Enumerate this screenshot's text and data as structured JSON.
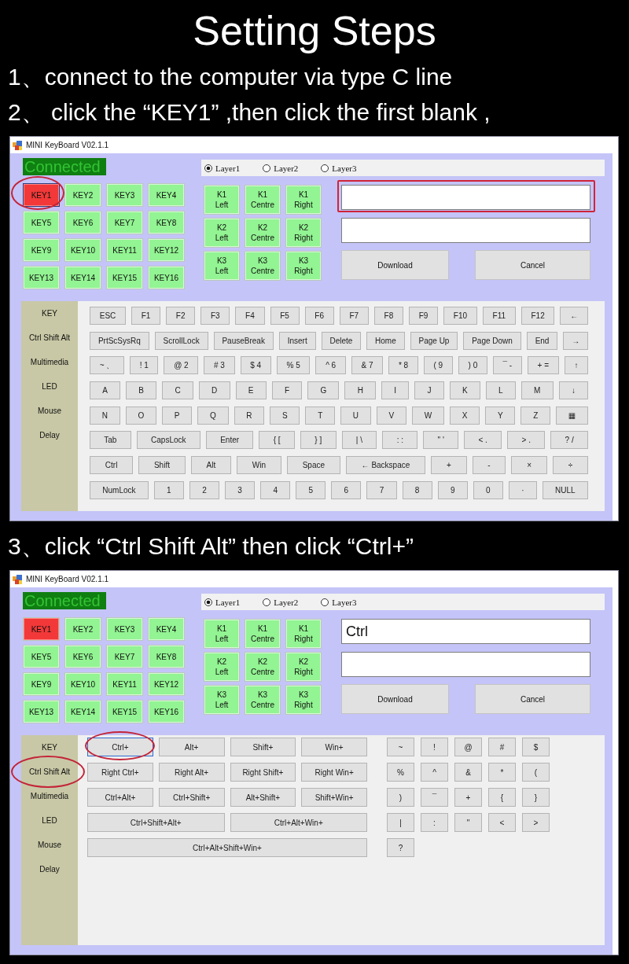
{
  "title": "Setting Steps",
  "sections": [
    {
      "steps": [
        "1、connect to the computer via type C line",
        "2、 click the “KEY1” ,then click the first blank ,"
      ],
      "window": {
        "title": "MINI KeyBoard V02.1.1",
        "status": "Connected",
        "keys": [
          {
            "label": "KEY1",
            "selected": true,
            "focused": true,
            "circled": true
          },
          {
            "label": "KEY2",
            "selected": false,
            "focused": false,
            "circled": false
          },
          {
            "label": "KEY3",
            "selected": false,
            "focused": false,
            "circled": false
          },
          {
            "label": "KEY4",
            "selected": false,
            "focused": false,
            "circled": false
          },
          {
            "label": "KEY5",
            "selected": false,
            "focused": false,
            "circled": false
          },
          {
            "label": "KEY6",
            "selected": false,
            "focused": false,
            "circled": false
          },
          {
            "label": "KEY7",
            "selected": false,
            "focused": false,
            "circled": false
          },
          {
            "label": "KEY8",
            "selected": false,
            "focused": false,
            "circled": false
          },
          {
            "label": "KEY9",
            "selected": false,
            "focused": false,
            "circled": false
          },
          {
            "label": "KEY10",
            "selected": false,
            "focused": false,
            "circled": false
          },
          {
            "label": "KEY11",
            "selected": false,
            "focused": false,
            "circled": false
          },
          {
            "label": "KEY12",
            "selected": false,
            "focused": false,
            "circled": false
          },
          {
            "label": "KEY13",
            "selected": false,
            "focused": false,
            "circled": false
          },
          {
            "label": "KEY14",
            "selected": false,
            "focused": false,
            "circled": false
          },
          {
            "label": "KEY15",
            "selected": false,
            "focused": false,
            "circled": false
          },
          {
            "label": "KEY16",
            "selected": false,
            "focused": false,
            "circled": false
          }
        ],
        "layers": [
          {
            "label": "Layer1",
            "selected": true
          },
          {
            "label": "Layer2",
            "selected": false
          },
          {
            "label": "Layer3",
            "selected": false
          }
        ],
        "knob_keys": [
          "K1\nLeft",
          "K1\nCentre",
          "K1\nRight",
          "K2\nLeft",
          "K2\nCentre",
          "K2\nRight",
          "K3\nLeft",
          "K3\nCentre",
          "K3\nRight"
        ],
        "fields": [
          {
            "highlighted": true
          },
          {
            "highlighted": false
          }
        ],
        "buttons": [
          "Download",
          "Cancel"
        ],
        "sidebar": [
          {
            "label": "KEY",
            "circled": false
          },
          {
            "label": "Ctrl Shift Alt",
            "circled": false
          },
          {
            "label": "Multimedia",
            "circled": false
          },
          {
            "label": "LED",
            "circled": false
          },
          {
            "label": "Mouse",
            "circled": false
          },
          {
            "label": "Delay",
            "circled": false
          }
        ],
        "panel": {
          "kind": "keyboard",
          "rows": [
            {
              "keys": [
                "ESC",
                "F1",
                "F2",
                "F3",
                "F4",
                "F5",
                "F6",
                "F7",
                "F8",
                "F9",
                "F10",
                "F11",
                "F12",
                "←"
              ]
            },
            {
              "keys": [
                "PrtScSysRq",
                "ScrollLock",
                "PauseBreak",
                "Insert",
                "Delete",
                "Home",
                "Page Up",
                "Page Down",
                "End",
                "→"
              ]
            },
            {
              "keys": [
                "~ 、",
                "! 1",
                "@ 2",
                "# 3",
                "$ 4",
                "% 5",
                "^ 6",
                "& 7",
                "* 8",
                "( 9",
                ") 0",
                "¯ -",
                "+ =",
                "↑"
              ]
            },
            {
              "keys": [
                "A",
                "B",
                "C",
                "D",
                "E",
                "F",
                "G",
                "H",
                "I",
                "J",
                "K",
                "L",
                "M",
                "↓"
              ]
            },
            {
              "keys": [
                "N",
                "O",
                "P",
                "Q",
                "R",
                "S",
                "T",
                "U",
                "V",
                "W",
                "X",
                "Y",
                "Z",
                "▦"
              ]
            },
            {
              "keys": [
                "Tab",
                "CapsLock",
                "Enter",
                "{ [",
                "} ]",
                "| \\",
                ": :",
                "\" '",
                "< .",
                "> .",
                "? /"
              ]
            },
            {
              "keys": [
                "Ctrl",
                "Shift",
                "Alt",
                "Win",
                "Space",
                "← Backspace",
                "+",
                "-",
                "×",
                "÷"
              ]
            },
            {
              "keys": [
                "NumLock",
                "1",
                "2",
                "3",
                "4",
                "5",
                "6",
                "7",
                "8",
                "9",
                "0",
                "·",
                "NULL"
              ]
            }
          ]
        }
      }
    },
    {
      "steps": [
        "3、click “Ctrl Shift Alt” then click “Ctrl+”"
      ],
      "window": {
        "title": "MINI KeyBoard V02.1.1",
        "status": "Connected",
        "keys": [
          {
            "label": "KEY1",
            "selected": true,
            "focused": false,
            "circled": false
          },
          {
            "label": "KEY2",
            "selected": false,
            "focused": false,
            "circled": false
          },
          {
            "label": "KEY3",
            "selected": false,
            "focused": false,
            "circled": false
          },
          {
            "label": "KEY4",
            "selected": false,
            "focused": false,
            "circled": false
          },
          {
            "label": "KEY5",
            "selected": false,
            "focused": false,
            "circled": false
          },
          {
            "label": "KEY6",
            "selected": false,
            "focused": false,
            "circled": false
          },
          {
            "label": "KEY7",
            "selected": false,
            "focused": false,
            "circled": false
          },
          {
            "label": "KEY8",
            "selected": false,
            "focused": false,
            "circled": false
          },
          {
            "label": "KEY9",
            "selected": false,
            "focused": false,
            "circled": false
          },
          {
            "label": "KEY10",
            "selected": false,
            "focused": false,
            "circled": false
          },
          {
            "label": "KEY11",
            "selected": false,
            "focused": false,
            "circled": false
          },
          {
            "label": "KEY12",
            "selected": false,
            "focused": false,
            "circled": false
          },
          {
            "label": "KEY13",
            "selected": false,
            "focused": false,
            "circled": false
          },
          {
            "label": "KEY14",
            "selected": false,
            "focused": false,
            "circled": false
          },
          {
            "label": "KEY15",
            "selected": false,
            "focused": false,
            "circled": false
          },
          {
            "label": "KEY16",
            "selected": false,
            "focused": false,
            "circled": false
          }
        ],
        "layers": [
          {
            "label": "Layer1",
            "selected": true
          },
          {
            "label": "Layer2",
            "selected": false
          },
          {
            "label": "Layer3",
            "selected": false
          }
        ],
        "knob_keys": [
          "K1\nLeft",
          "K1\nCentre",
          "K1\nRight",
          "K2\nLeft",
          "K2\nCentre",
          "K2\nRight",
          "K3\nLeft",
          "K3\nCentre",
          "K3\nRight"
        ],
        "fields": [
          {
            "value": "Ctrl",
            "highlighted": false
          },
          {
            "highlighted": false
          }
        ],
        "buttons": [
          "Download",
          "Cancel"
        ],
        "sidebar": [
          {
            "label": "KEY",
            "circled": false
          },
          {
            "label": "Ctrl Shift Alt",
            "circled": true
          },
          {
            "label": "Multimedia",
            "circled": false
          },
          {
            "label": "LED",
            "circled": false
          },
          {
            "label": "Mouse",
            "circled": false
          },
          {
            "label": "Delay",
            "circled": false
          }
        ],
        "panel": {
          "kind": "modifiers",
          "combos": [
            [
              {
                "label": "Ctrl+",
                "focused": true,
                "circled": true
              },
              {
                "label": "Alt+",
                "focused": false,
                "circled": false
              },
              {
                "label": "Shift+",
                "focused": false,
                "circled": false
              },
              {
                "label": "Win+",
                "focused": false,
                "circled": false
              }
            ],
            [
              {
                "label": "Right Ctrl+",
                "focused": false,
                "circled": false
              },
              {
                "label": "Right Alt+",
                "focused": false,
                "circled": false
              },
              {
                "label": "Right Shift+",
                "focused": false,
                "circled": false
              },
              {
                "label": "Right Win+",
                "focused": false,
                "circled": false
              }
            ],
            [
              {
                "label": "Ctrl+Alt+",
                "focused": false,
                "circled": false
              },
              {
                "label": "Ctrl+Shift+",
                "focused": false,
                "circled": false
              },
              {
                "label": "Alt+Shift+",
                "focused": false,
                "circled": false
              },
              {
                "label": "Shift+Win+",
                "focused": false,
                "circled": false
              }
            ],
            [
              {
                "label": "Ctrl+Shift+Alt+",
                "focused": false,
                "circled": false
              },
              {
                "label": "Ctrl+Alt+Win+",
                "focused": false,
                "circled": false
              }
            ],
            [
              {
                "label": "Ctrl+Alt+Shift+Win+",
                "focused": false,
                "circled": false
              }
            ]
          ],
          "symbols": [
            [
              "~",
              "!",
              "@",
              "#",
              "$"
            ],
            [
              "%",
              "^",
              "&",
              "*",
              "("
            ],
            [
              ")",
              "¯",
              "+",
              "{",
              "}"
            ],
            [
              "|",
              ":",
              "\"",
              "<",
              ">"
            ],
            [
              "?"
            ]
          ]
        }
      }
    }
  ]
}
